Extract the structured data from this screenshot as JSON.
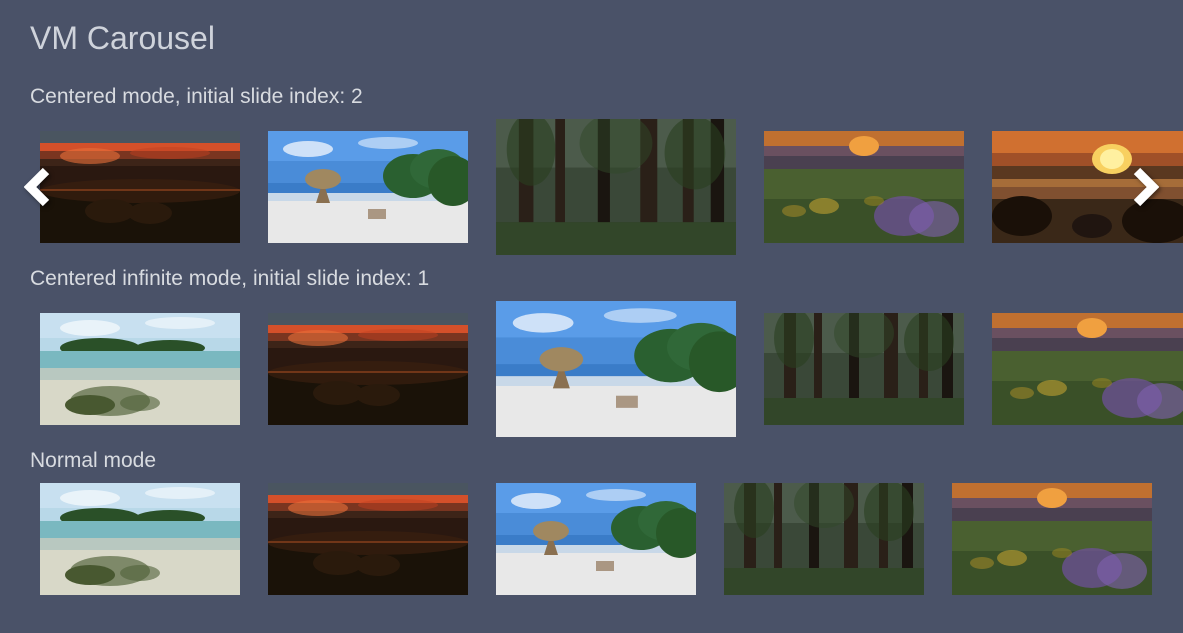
{
  "page_title": "VM Carousel",
  "carousels": [
    {
      "title": "Centered mode, initial slide index: 2",
      "has_arrows": true,
      "active_index": 2,
      "slides": [
        "sunset-pipes",
        "beach-umbrella",
        "forest-path",
        "meadow-flowers",
        "ocean-sunset"
      ]
    },
    {
      "title": "Centered infinite mode, initial slide index: 1",
      "has_arrows": false,
      "active_index": 2,
      "slides": [
        "tropical-beach",
        "sunset-pipes",
        "beach-umbrella",
        "forest-path",
        "meadow-flowers"
      ]
    },
    {
      "title": "Normal mode",
      "has_arrows": false,
      "active_index": -1,
      "slides": [
        "tropical-beach",
        "sunset-pipes",
        "beach-umbrella",
        "forest-path",
        "meadow-flowers"
      ]
    }
  ],
  "image_defs": {
    "sunset-pipes": "sunset-pipes",
    "beach-umbrella": "beach-umbrella",
    "forest-path": "forest-path",
    "meadow-flowers": "meadow-flowers",
    "ocean-sunset": "ocean-sunset",
    "tropical-beach": "tropical-beach"
  },
  "icons": {
    "prev": "chevron-left-icon",
    "next": "chevron-right-icon"
  }
}
